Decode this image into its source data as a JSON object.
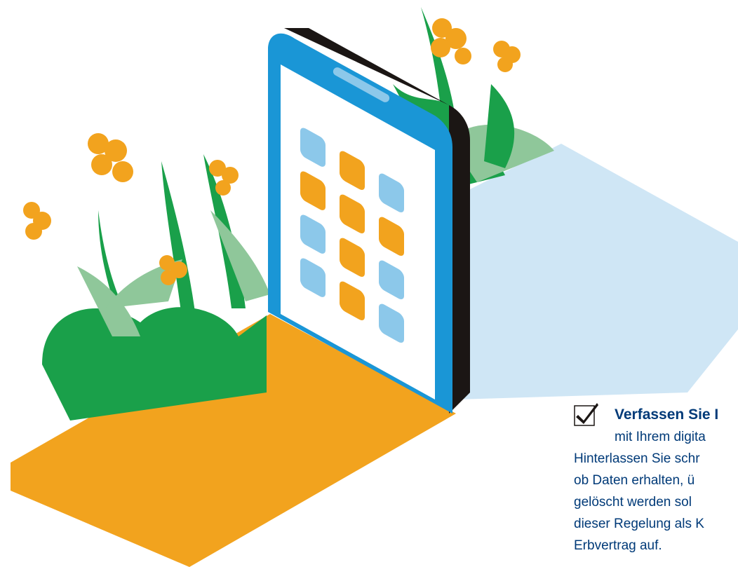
{
  "callout": {
    "title": "Verfassen Sie I",
    "lines": [
      "mit Ihrem digita",
      "Hinterlassen Sie schr",
      "ob Daten erhalten, ü",
      "gelöscht werden sol",
      "dieser Regelung als K",
      "Erbvertrag auf."
    ]
  },
  "colors": {
    "text": "#003a78",
    "orange": "#f2a31e",
    "green": "#1aa04a",
    "light_green": "#8fc79a",
    "phone_blue": "#1a96d6",
    "phone_frame": "#1b1614",
    "tile_blue": "#8cc8ea",
    "floor_blue": "#cfe6f5"
  },
  "icons": [
    "checkmark-icon",
    "smartphone-illustration",
    "flower-icon"
  ]
}
